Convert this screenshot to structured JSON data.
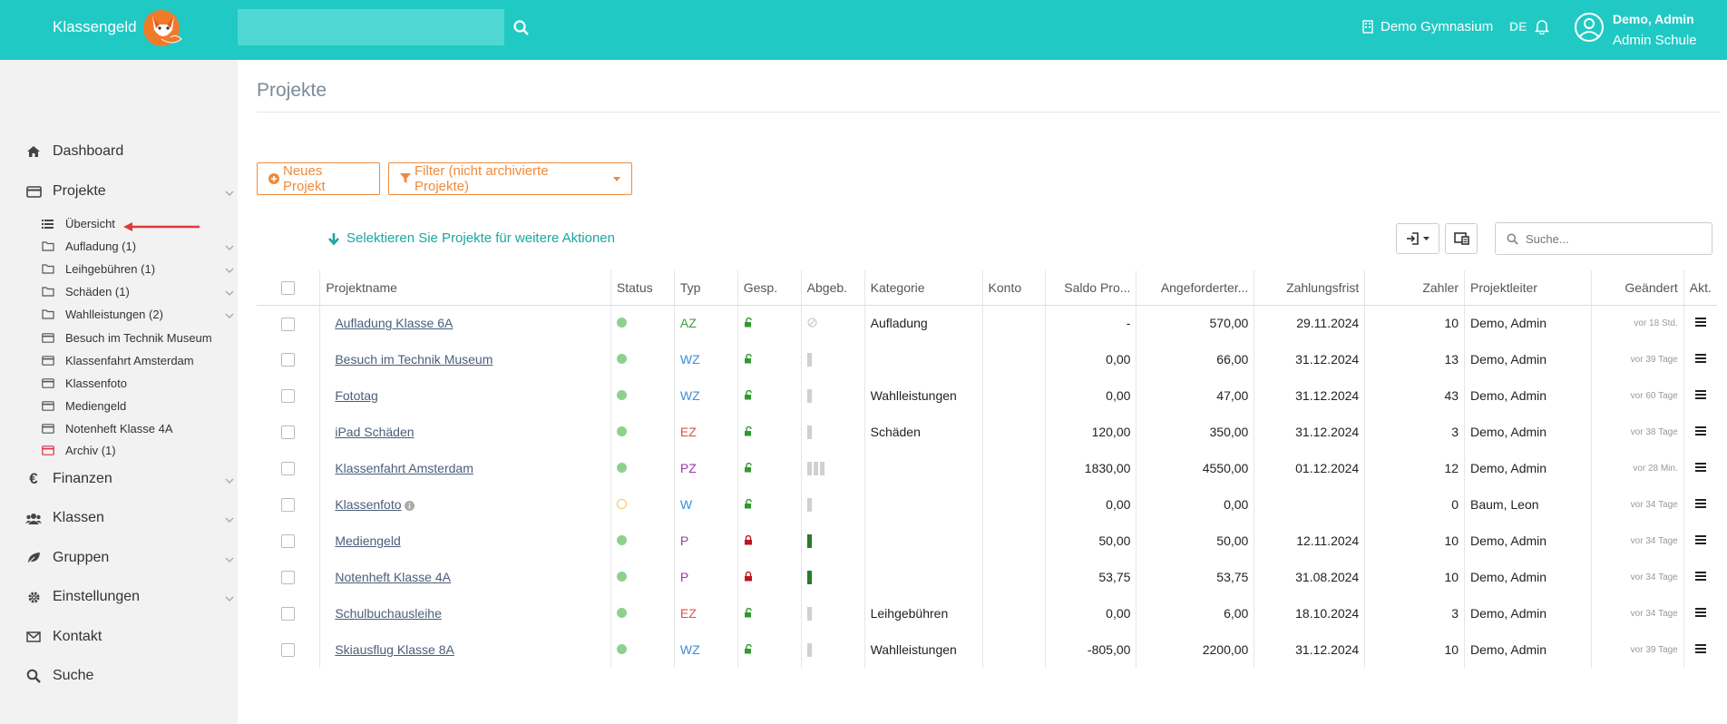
{
  "header": {
    "brand": "Klassengeld",
    "search_placeholder": "",
    "school": "Demo Gymnasium",
    "language": "DE",
    "user_name": "Demo, Admin",
    "user_role": "Admin Schule",
    "accent_color": "#20c9c4"
  },
  "sidebar": {
    "dashboard": "Dashboard",
    "projekte": "Projekte",
    "sub_items": [
      {
        "label": "Übersicht",
        "icon": "list-icon"
      },
      {
        "label": "Aufladung (1)",
        "icon": "folder-icon"
      },
      {
        "label": "Leihgebühren (1)",
        "icon": "folder-icon"
      },
      {
        "label": "Schäden (1)",
        "icon": "folder-icon"
      },
      {
        "label": "Wahlleistungen (2)",
        "icon": "folder-icon"
      },
      {
        "label": "Besuch im Technik Museum",
        "icon": "card-icon"
      },
      {
        "label": "Klassenfahrt Amsterdam",
        "icon": "card-icon"
      },
      {
        "label": "Klassenfoto",
        "icon": "card-icon"
      },
      {
        "label": "Mediengeld",
        "icon": "card-icon"
      },
      {
        "label": "Notenheft Klasse 4A",
        "icon": "card-icon"
      },
      {
        "label": "Archiv (1)",
        "icon": "archive-icon"
      }
    ],
    "finanzen": "Finanzen",
    "klassen": "Klassen",
    "gruppen": "Gruppen",
    "einstellungen": "Einstellungen",
    "kontakt": "Kontakt",
    "suche": "Suche"
  },
  "main": {
    "title": "Projekte",
    "new_project": "Neues Projekt",
    "filter": "Filter (nicht archivierte Projekte)",
    "select_hint": "Selektieren Sie Projekte für weitere Aktionen",
    "search_placeholder": "Suche..."
  },
  "table": {
    "headers": [
      "Projektname",
      "Status",
      "Typ",
      "Gesp.",
      "Abgeb.",
      "Kategorie",
      "Konto",
      "Saldo Pro...",
      "Angeforderter...",
      "Zahlungsfrist",
      "Zahler",
      "Projektleiter",
      "Geändert",
      "Akt."
    ],
    "rows": [
      {
        "name": "Aufladung Klasse 6A",
        "status": "green",
        "typ": "AZ",
        "typ_color": "#3aa03a",
        "locked": false,
        "abgeb": "none",
        "kategorie": "Aufladung",
        "saldo": "-",
        "angefordert": "570,00",
        "frist": "29.11.2024",
        "zahler": "10",
        "leiter": "Demo, Admin",
        "geaendert": "vor 18 Std."
      },
      {
        "name": "Besuch im Technik Museum",
        "status": "green",
        "typ": "WZ",
        "typ_color": "#3a8fd6",
        "locked": false,
        "abgeb": "gray1",
        "kategorie": "",
        "saldo": "0,00",
        "angefordert": "66,00",
        "frist": "31.12.2024",
        "zahler": "13",
        "leiter": "Demo, Admin",
        "geaendert": "vor 39 Tage"
      },
      {
        "name": "Fototag",
        "status": "green",
        "typ": "WZ",
        "typ_color": "#3a8fd6",
        "locked": false,
        "abgeb": "gray1",
        "kategorie": "Wahlleistungen",
        "saldo": "0,00",
        "angefordert": "47,00",
        "frist": "31.12.2024",
        "zahler": "43",
        "leiter": "Demo, Admin",
        "geaendert": "vor 60 Tage"
      },
      {
        "name": "iPad Schäden",
        "status": "green",
        "typ": "EZ",
        "typ_color": "#d9534f",
        "locked": false,
        "abgeb": "gray1",
        "kategorie": "Schäden",
        "saldo": "120,00",
        "angefordert": "350,00",
        "frist": "31.12.2024",
        "zahler": "3",
        "leiter": "Demo, Admin",
        "geaendert": "vor 38 Tage"
      },
      {
        "name": "Klassenfahrt Amsterdam",
        "status": "green",
        "typ": "PZ",
        "typ_color": "#9b3aa8",
        "locked": false,
        "abgeb": "gray3",
        "kategorie": "",
        "saldo": "1830,00",
        "angefordert": "4550,00",
        "frist": "01.12.2024",
        "zahler": "12",
        "leiter": "Demo, Admin",
        "geaendert": "vor 28 Min."
      },
      {
        "name": "Klassenfoto",
        "status": "open",
        "typ": "W",
        "typ_color": "#3a8fd6",
        "locked": false,
        "abgeb": "gray1",
        "kategorie": "",
        "saldo": "0,00",
        "angefordert": "0,00",
        "frist": "",
        "zahler": "0",
        "leiter": "Baum, Leon",
        "geaendert": "vor 34 Tage",
        "info": true
      },
      {
        "name": "Mediengeld",
        "status": "green",
        "typ": "P",
        "typ_color": "#9b3aa8",
        "locked": true,
        "abgeb": "green1",
        "kategorie": "",
        "saldo": "50,00",
        "angefordert": "50,00",
        "frist": "12.11.2024",
        "zahler": "10",
        "leiter": "Demo, Admin",
        "geaendert": "vor 34 Tage"
      },
      {
        "name": "Notenheft Klasse 4A",
        "status": "green",
        "typ": "P",
        "typ_color": "#9b3aa8",
        "locked": true,
        "abgeb": "green1",
        "kategorie": "",
        "saldo": "53,75",
        "angefordert": "53,75",
        "frist": "31.08.2024",
        "zahler": "10",
        "leiter": "Demo, Admin",
        "geaendert": "vor 34 Tage"
      },
      {
        "name": "Schulbuchausleihe",
        "status": "green",
        "typ": "EZ",
        "typ_color": "#d9534f",
        "locked": false,
        "abgeb": "gray1",
        "kategorie": "Leihgebühren",
        "saldo": "0,00",
        "angefordert": "6,00",
        "frist": "18.10.2024",
        "zahler": "3",
        "leiter": "Demo, Admin",
        "geaendert": "vor 34 Tage"
      },
      {
        "name": "Skiausflug Klasse 8A",
        "status": "green",
        "typ": "WZ",
        "typ_color": "#3a8fd6",
        "locked": false,
        "abgeb": "gray1",
        "kategorie": "Wahlleistungen",
        "saldo": "-805,00",
        "angefordert": "2200,00",
        "frist": "31.12.2024",
        "zahler": "10",
        "leiter": "Demo, Admin",
        "geaendert": "vor 39 Tage"
      }
    ]
  }
}
